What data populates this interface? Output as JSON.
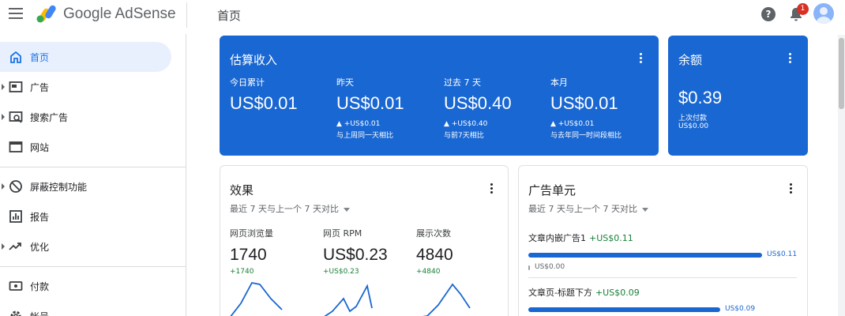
{
  "app": {
    "brand": "Google AdSense",
    "page_title": "首页",
    "notification_count": "1"
  },
  "colors": {
    "primary": "#1967d2",
    "positive": "#188038",
    "active_bg": "#e8f0fe",
    "badge": "#d93025"
  },
  "sidebar": {
    "items": [
      {
        "label": "首页",
        "icon": "home-icon",
        "active": true
      },
      {
        "label": "广告",
        "icon": "ads-icon",
        "expandable": true
      },
      {
        "label": "搜索广告",
        "icon": "search-ads-icon",
        "expandable": true
      },
      {
        "label": "网站",
        "icon": "sites-icon"
      },
      {
        "label": "屏蔽控制功能",
        "icon": "block-icon",
        "expandable": true
      },
      {
        "label": "报告",
        "icon": "reports-icon"
      },
      {
        "label": "优化",
        "icon": "optimize-icon",
        "expandable": true
      },
      {
        "label": "付款",
        "icon": "payments-icon"
      },
      {
        "label": "帐号",
        "icon": "account-icon"
      }
    ]
  },
  "earnings": {
    "title": "估算收入",
    "stats": [
      {
        "label": "今日累计",
        "value": "US$0.01",
        "delta": "",
        "compare": ""
      },
      {
        "label": "昨天",
        "value": "US$0.01",
        "delta": "▲ +US$0.01",
        "compare": "与上周同一天相比"
      },
      {
        "label": "过去 7 天",
        "value": "US$0.40",
        "delta": "▲ +US$0.40",
        "compare": "与前7天相比"
      },
      {
        "label": "本月",
        "value": "US$0.01",
        "delta": "▲ +US$0.01",
        "compare": "与去年同一时间段相比"
      }
    ]
  },
  "balance": {
    "title": "余额",
    "value": "$0.39",
    "last_payment_label": "上次付款",
    "last_payment_value": "US$0.00"
  },
  "performance": {
    "title": "效果",
    "period": "最近 7 天与上一个 7 天对比",
    "metrics": [
      {
        "label": "网页浏览量",
        "value": "1740",
        "delta": "+1740"
      },
      {
        "label": "网页 RPM",
        "value": "US$0.23",
        "delta": "+US$0.23"
      },
      {
        "label": "展示次数",
        "value": "4840",
        "delta": "+4840"
      }
    ]
  },
  "ad_units": {
    "title": "广告单元",
    "period": "最近 7 天与上一个 7 天对比",
    "units": [
      {
        "name": "文章内嵌广告1",
        "change": "+US$0.11",
        "value": "US$0.11",
        "previous": "US$0.00",
        "share": 1.0
      },
      {
        "name": "文章页-标题下方",
        "change": "+US$0.09",
        "value": "US$0.09",
        "previous": "",
        "share": 0.82
      }
    ]
  }
}
